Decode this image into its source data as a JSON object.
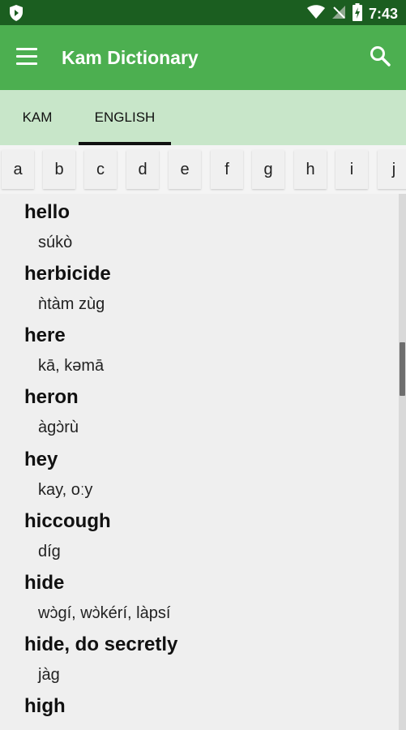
{
  "status_bar": {
    "time": "7:43"
  },
  "app_bar": {
    "title": "Kam Dictionary"
  },
  "tabs": [
    {
      "label": "KAM"
    },
    {
      "label": "ENGLISH"
    }
  ],
  "letters": [
    "a",
    "b",
    "c",
    "d",
    "e",
    "f",
    "g",
    "h",
    "i",
    "j"
  ],
  "entries": [
    {
      "word": "hello",
      "translation": "súkò"
    },
    {
      "word": "herbicide",
      "translation": "ǹtàm zùg"
    },
    {
      "word": "here",
      "translation": "kā, kəmā"
    },
    {
      "word": "heron",
      "translation": "àgɔ̀rù"
    },
    {
      "word": "hey",
      "translation": "kay, oːy"
    },
    {
      "word": "hiccough",
      "translation": "díg"
    },
    {
      "word": "hide",
      "translation": "wɔ̀gí, wɔ̀kérí, làpsí"
    },
    {
      "word": "hide, do secretly",
      "translation": "jàg"
    },
    {
      "word": "high",
      "translation": ""
    }
  ],
  "colors": {
    "status_bar": "#1b5e20",
    "app_bar": "#4caf50",
    "tabs_bg": "#c8e6c9",
    "list_bg": "#efefef"
  }
}
